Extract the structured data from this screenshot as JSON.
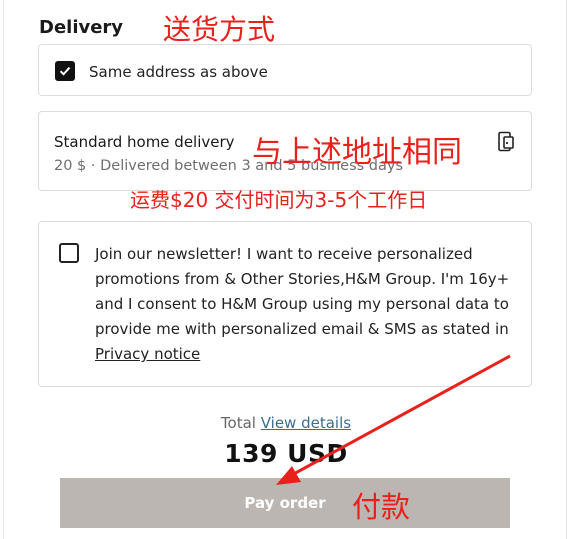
{
  "section": {
    "title": "Delivery"
  },
  "same_address": {
    "label": "Same address as above",
    "checked": true
  },
  "delivery_option": {
    "name": "Standard home delivery",
    "detail": "20 $ · Delivered between 3 and 5 business days",
    "icon": "door-icon"
  },
  "newsletter": {
    "text": "Join our newsletter! I want to receive personalized promotions from & Other Stories,H&M Group. I'm 16y+ and I consent to H&M Group using my personal data to provide me with personalized email & SMS as stated in ",
    "link": "Privacy notice",
    "checked": false
  },
  "total": {
    "label": "Total",
    "link": "View details",
    "amount": "139 USD"
  },
  "pay": {
    "label": "Pay order",
    "color": "#bcb6b2"
  },
  "annotations": {
    "delivery": "送货方式",
    "address": "与上述地址相同",
    "fee": "运费$20 交付时间为3-5个工作日",
    "pay": "付款",
    "color": "#e8211d"
  }
}
